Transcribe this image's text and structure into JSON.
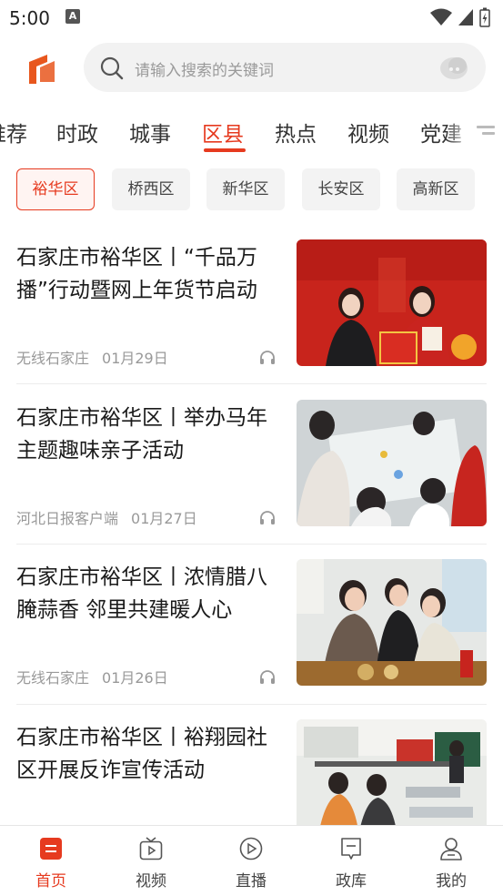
{
  "status_bar": {
    "time": "5:00",
    "notification_badge": "A"
  },
  "search": {
    "placeholder": "请输入搜索的关键词"
  },
  "tabs": [
    {
      "label": "推荐"
    },
    {
      "label": "时政"
    },
    {
      "label": "城事"
    },
    {
      "label": "区县"
    },
    {
      "label": "热点"
    },
    {
      "label": "视频"
    },
    {
      "label": "党建"
    }
  ],
  "chips": [
    {
      "label": "裕华区"
    },
    {
      "label": "桥西区"
    },
    {
      "label": "新华区"
    },
    {
      "label": "长安区"
    },
    {
      "label": "高新区"
    }
  ],
  "articles": [
    {
      "title": "石家庄市裕华区丨“千品万播”行动暨网上年货节启动",
      "source": "无线石家庄",
      "date": "01月29日"
    },
    {
      "title": "石家庄市裕华区丨举办马年主题趣味亲子活动",
      "source": "河北日报客户端",
      "date": "01月27日"
    },
    {
      "title": "石家庄市裕华区丨浓情腊八腌蒜香 邻里共建暖人心",
      "source": "无线石家庄",
      "date": "01月26日"
    },
    {
      "title": "石家庄市裕华区丨裕翔园社区开展反诈宣传活动",
      "source": "",
      "date": ""
    }
  ],
  "bottom_nav": [
    {
      "label": "首页"
    },
    {
      "label": "视频"
    },
    {
      "label": "直播"
    },
    {
      "label": "政库"
    },
    {
      "label": "我的"
    }
  ],
  "colors": {
    "accent": "#e63a1f",
    "brand_logo": "#e8571e",
    "text_secondary": "#999999"
  }
}
